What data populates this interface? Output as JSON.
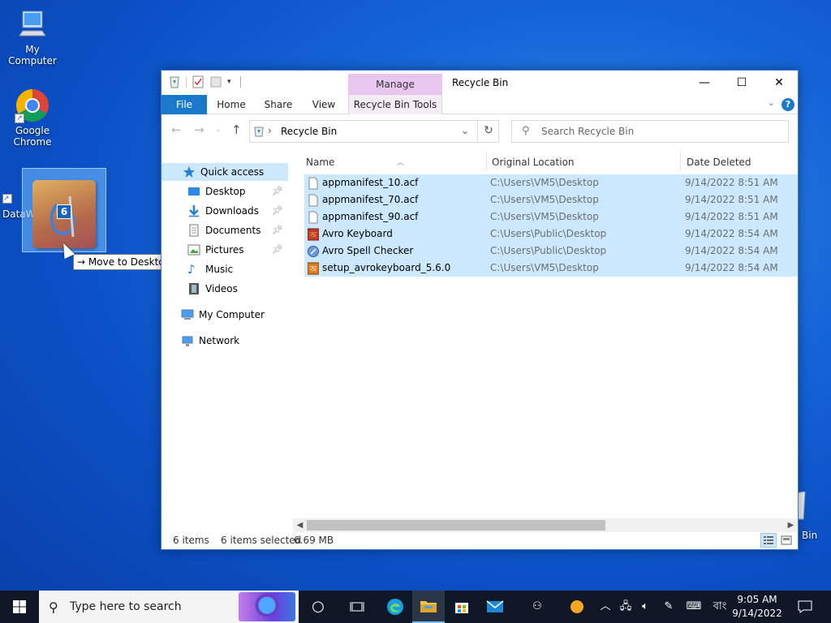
{
  "desktop": {
    "icons": [
      {
        "label": "My Computer"
      },
      {
        "label": "Google Chrome"
      },
      {
        "label": "DataW"
      }
    ],
    "recycle_bin_label": "Bin",
    "drag": {
      "badge_count": "6",
      "tooltip": "Move to Desktop",
      "tooltip_arrow": "→"
    }
  },
  "window": {
    "title": "Recycle Bin",
    "contextual_tab": "Manage",
    "ribbon_tabs": [
      {
        "label": "File"
      },
      {
        "label": "Home"
      },
      {
        "label": "Share"
      },
      {
        "label": "View"
      },
      {
        "label": "Recycle Bin Tools"
      }
    ],
    "help_label": "?",
    "address": {
      "breadcrumb": "Recycle Bin",
      "separator": "›"
    },
    "search_placeholder": "Search Recycle Bin",
    "nav": [
      {
        "label": "Quick access",
        "pinned": false
      },
      {
        "label": "Desktop",
        "pinned": true
      },
      {
        "label": "Downloads",
        "pinned": true
      },
      {
        "label": "Documents",
        "pinned": true
      },
      {
        "label": "Pictures",
        "pinned": true
      },
      {
        "label": "Music",
        "pinned": false
      },
      {
        "label": "Videos",
        "pinned": false
      },
      {
        "label": "My Computer",
        "pinned": false
      },
      {
        "label": "Network",
        "pinned": false
      }
    ],
    "columns": [
      "Name",
      "Original Location",
      "Date Deleted"
    ],
    "files": [
      {
        "name": "appmanifest_10.acf",
        "location": "C:\\Users\\VM5\\Desktop",
        "date": "9/14/2022 8:51 AM",
        "icon": "document-icon"
      },
      {
        "name": "appmanifest_70.acf",
        "location": "C:\\Users\\VM5\\Desktop",
        "date": "9/14/2022 8:51 AM",
        "icon": "document-icon"
      },
      {
        "name": "appmanifest_90.acf",
        "location": "C:\\Users\\VM5\\Desktop",
        "date": "9/14/2022 8:51 AM",
        "icon": "document-icon"
      },
      {
        "name": "Avro Keyboard",
        "location": "C:\\Users\\Public\\Desktop",
        "date": "9/14/2022 8:54 AM",
        "icon": "avro-keyboard-icon"
      },
      {
        "name": "Avro Spell Checker",
        "location": "C:\\Users\\Public\\Desktop",
        "date": "9/14/2022 8:54 AM",
        "icon": "spell-checker-icon"
      },
      {
        "name": "setup_avrokeyboard_5.6.0",
        "location": "C:\\Users\\VM5\\Desktop",
        "date": "9/14/2022 8:54 AM",
        "icon": "installer-icon"
      }
    ],
    "status": {
      "item_count": "6 items",
      "selected": "6 items selected",
      "size": "6.69 MB"
    }
  },
  "taskbar": {
    "search_placeholder": "Type here to search",
    "language": "বাং",
    "time": "9:05 AM",
    "date": "9/14/2022"
  },
  "colors": {
    "accent": "#1979ca",
    "selection": "#cce8ff",
    "manage_tab": "#e9c6f0"
  }
}
